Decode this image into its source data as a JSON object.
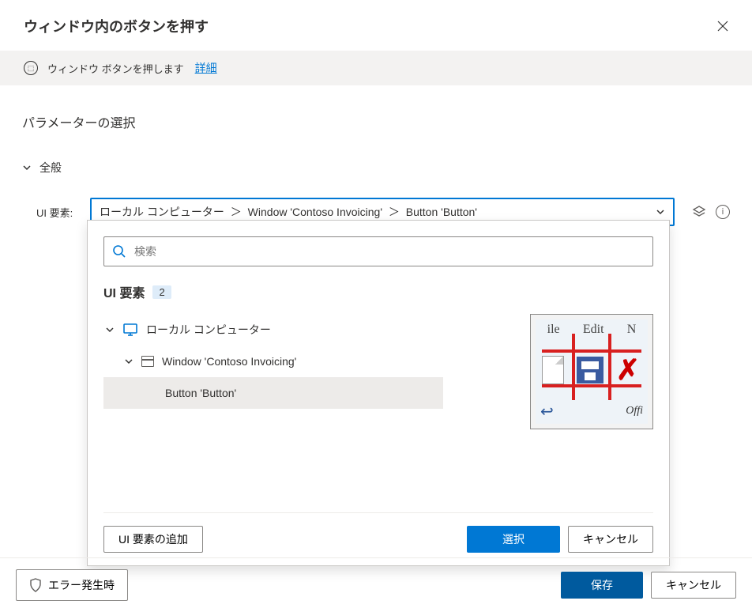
{
  "header": {
    "title": "ウィンドウ内のボタンを押す"
  },
  "info": {
    "text": "ウィンドウ ボタンを押します",
    "link": "詳細"
  },
  "section_title": "パラメーターの選択",
  "general_label": "全般",
  "param": {
    "label": "UI 要素:",
    "breadcrumb": {
      "p1": "ローカル コンピューター",
      "p2": "Window 'Contoso Invoicing'",
      "p3": "Button 'Button'"
    }
  },
  "dropdown": {
    "search_placeholder": "検索",
    "title": "UI 要素",
    "count": "2",
    "tree": {
      "root": "ローカル コンピューター",
      "window": "Window 'Contoso Invoicing'",
      "button": "Button 'Button'"
    },
    "thumbnail_menu": {
      "left": "ile",
      "mid": "Edit",
      "right": "N"
    },
    "footer": {
      "add": "UI 要素の追加",
      "select": "選択",
      "cancel": "キャンセル"
    }
  },
  "footer": {
    "on_error": "エラー発生時",
    "save": "保存",
    "cancel": "キャンセル"
  }
}
